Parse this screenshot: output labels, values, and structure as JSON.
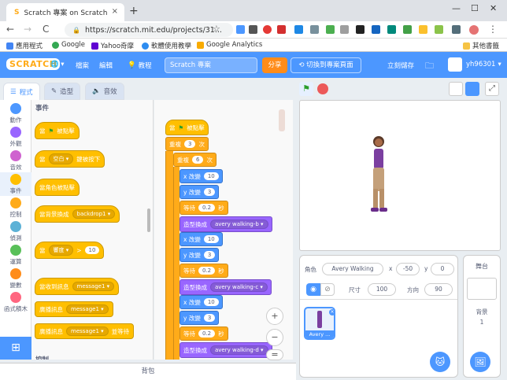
{
  "browser": {
    "tab_title": "Scratch 專案 on Scratch",
    "tab_close": "×",
    "new_tab": "+",
    "url": "https://scratch.mit.edu/projects/31...",
    "window_controls": [
      "—",
      "☐",
      "✕"
    ],
    "nav": {
      "back": "←",
      "forward": "→",
      "reload": "C"
    }
  },
  "bookmarks": [
    {
      "label": "應用程式",
      "color": "#4285f4"
    },
    {
      "label": "Google",
      "color": "#34a853"
    },
    {
      "label": "Yahoo奇摩",
      "color": "#6001d2"
    },
    {
      "label": "軟體使用教學",
      "color": "#2d8cf0"
    },
    {
      "label": "Google Analytics",
      "color": "#f9ab00"
    }
  ],
  "bookmarks_other": "其他書籤",
  "menubar": {
    "logo": "SCRATCH",
    "file": "檔案",
    "edit": "編輯",
    "tutorials": "教程",
    "project_title": "Scratch 專案",
    "share": "分享",
    "see_project": "切換到專案頁面",
    "save_now": "立刻儲存",
    "username": "yh96301"
  },
  "editor_tabs": {
    "code": "程式",
    "costumes": "造型",
    "sounds": "音效"
  },
  "categories": [
    {
      "label": "動作",
      "color": "#4c97ff"
    },
    {
      "label": "外觀",
      "color": "#9966ff"
    },
    {
      "label": "音效",
      "color": "#cf63cf"
    },
    {
      "label": "事件",
      "color": "#ffbf00"
    },
    {
      "label": "控制",
      "color": "#ffab19"
    },
    {
      "label": "偵測",
      "color": "#5cb1d6"
    },
    {
      "label": "運算",
      "color": "#59c059"
    },
    {
      "label": "變數",
      "color": "#ff8c1a"
    },
    {
      "label": "函式積木",
      "color": "#ff6680"
    }
  ],
  "palette": {
    "heading": "事件",
    "b1": "當",
    "b1b": "被點擊",
    "b2a": "當",
    "b2key": "空白 ▾",
    "b2b": "鍵被按下",
    "b3": "當角色被點擊",
    "b4a": "當背景換成",
    "b4drop": "backdrop1 ▾",
    "b5a": "當",
    "b5drop": "響度 ▾",
    "b5op": ">",
    "b5val": "10",
    "b6a": "當收到訊息",
    "b6drop": "message1 ▾",
    "b7a": "廣播訊息",
    "b7drop": "message1 ▾",
    "b8a": "廣播訊息",
    "b8drop": "message1 ▾",
    "b8b": "並等待",
    "cut": "控制"
  },
  "script": {
    "hat_a": "當",
    "hat_b": "被點擊",
    "repeat": "重複",
    "repeat_val": "3",
    "times": "次",
    "repeat2_val": "6",
    "change_x": "x 改變",
    "change_y": "y 改變",
    "val10": "10",
    "val3": "3",
    "wait": "等待",
    "wait_val": "0.2",
    "sec": "秒",
    "switch": "造型換成",
    "cost_b": "avery walking-b ▾",
    "cost_c": "avery walking-c ▾",
    "cost_d": "avery walking-d ▾"
  },
  "zoom": {
    "in": "+",
    "out": "−",
    "reset": "="
  },
  "bottom_label": "背包",
  "sprite": {
    "label": "角色",
    "name": "Avery Walking",
    "x_label": "x",
    "x": "-50",
    "y_label": "y",
    "y": "0",
    "show_label": "顯示",
    "size_label": "尺寸",
    "size": "100",
    "dir_label": "方向",
    "direction": "90",
    "thumb_name": "Avery ..."
  },
  "stage_panel": {
    "title": "舞台",
    "backdrop_label": "背景",
    "backdrop_count": "1"
  }
}
